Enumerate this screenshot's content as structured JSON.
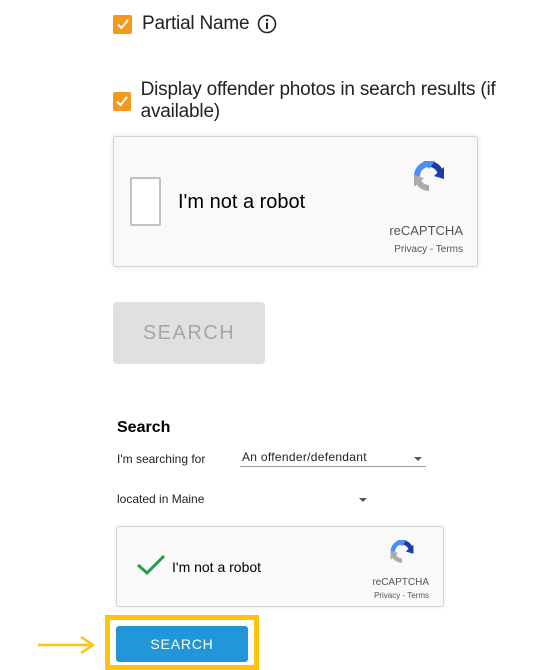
{
  "options": {
    "partial_name": {
      "label": "Partial Name",
      "checked": true
    },
    "display_photos": {
      "label": "Display offender photos in search results (if available)",
      "checked": true
    }
  },
  "recaptcha_large": {
    "label": "I'm not a robot",
    "brand": "reCAPTCHA",
    "terms": "Privacy - Terms",
    "state": "unchecked"
  },
  "search_disabled": {
    "label": "SEARCH"
  },
  "lower_form": {
    "heading": "Search",
    "searching_for_label": "I'm searching for",
    "searching_for_value": "An offender/defendant",
    "location_value": "located in Maine",
    "recaptcha": {
      "label": "I'm not a robot",
      "brand": "reCAPTCHA",
      "terms": "Privacy - Terms",
      "state": "checked"
    },
    "search_button": "SEARCH"
  },
  "colors": {
    "checkbox_orange": "#f39a1e",
    "highlight_yellow": "#ffc20e",
    "primary_blue": "#2196d9",
    "check_green": "#1e9e45"
  }
}
